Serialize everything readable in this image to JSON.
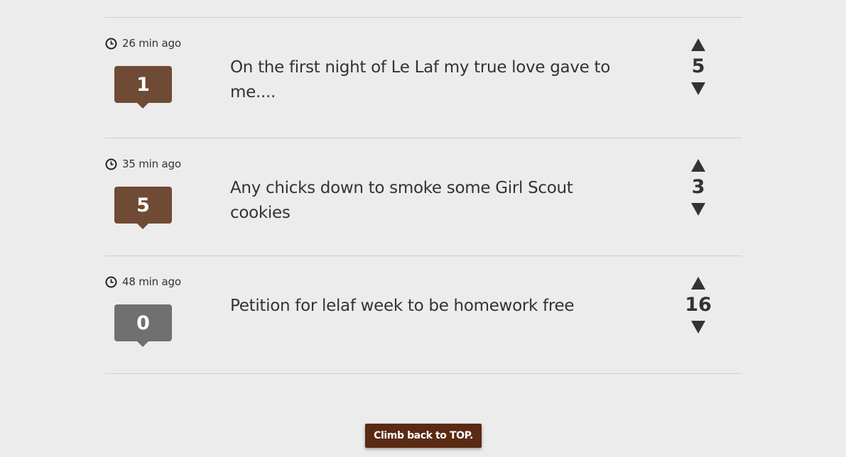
{
  "posts": [
    {
      "time": "26 min ago",
      "comments": "1",
      "title": "On the first night of Le Laf my true love gave to me....",
      "score": "5"
    },
    {
      "time": "35 min ago",
      "comments": "5",
      "title": "Any chicks down to smoke some Girl Scout cookies",
      "score": "3"
    },
    {
      "time": "48 min ago",
      "comments": "0",
      "title": "Petition for lelaf week to be homework free",
      "score": "16"
    }
  ],
  "footer": {
    "top_button_label": "Climb back to TOP."
  },
  "icons": {
    "time": "clock-icon",
    "upvote": "triangle-up-icon",
    "downvote": "triangle-down-icon"
  },
  "colors": {
    "background": "#ececec",
    "badge_active": "#6f4a34",
    "badge_zero": "#707070",
    "top_button": "#5a2a13",
    "text": "#333333"
  }
}
